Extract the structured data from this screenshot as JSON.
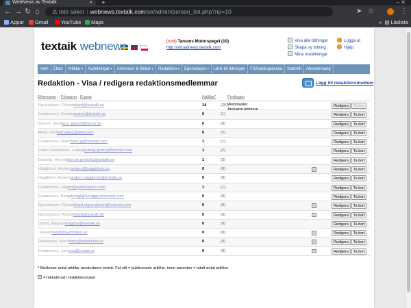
{
  "browser": {
    "tab_title": "WebNews av Textalk",
    "new_tab": "+",
    "window_controls": "– ✕",
    "insecure_label": "Inte säker",
    "url_host": "webnews.textalk.com",
    "url_path": "/se/admin/person_list.php?np=10",
    "bookmarks": [
      "Appar",
      "Gmail",
      "YouTube",
      "Maps"
    ],
    "bookmarks_right": "Läslista",
    "icons": {
      "back": "←",
      "forward": "→",
      "reload": "↻",
      "home": "⌂",
      "warning": "⚠",
      "share": "➤",
      "star": "☆",
      "menu": "⋮",
      "bookmarks_overflow": "»",
      "reading_list": "▤"
    }
  },
  "header": {
    "logo_primary": "textaik",
    "logo_secondary": "webnews",
    "root_tag": "(root)",
    "site_name": "Tanums Motorspegel (10)",
    "site_url": "http://virtualnews.textalk.com",
    "links_left": [
      "Visa alla tidningar",
      "Skapa ny tidning",
      "Mina inställningar"
    ],
    "links_right": [
      "Logga ut",
      "Hjälp"
    ]
  },
  "nav": [
    {
      "label": "Hem",
      "caret": false
    },
    {
      "label": "Ettan",
      "caret": false
    },
    {
      "label": "Artiklar",
      "caret": true
    },
    {
      "label": "Avdelningar",
      "caret": true
    },
    {
      "label": "Annonser & länkar",
      "caret": true
    },
    {
      "label": "Redaktion",
      "caret": true
    },
    {
      "label": "Egenskaper",
      "caret": true
    },
    {
      "label": "Länk till tidningen",
      "caret": false
    },
    {
      "label": "Förhandsgranska",
      "caret": false
    },
    {
      "label": "Statistik",
      "caret": false
    },
    {
      "label": "Abonnemang",
      "caret": false
    }
  ],
  "page": {
    "title": "Redaktion - Visa / redigera redaktionsmedlemmar",
    "add_member_label": "Lägg till redaktionsmedlem"
  },
  "table": {
    "columns": {
      "surname": "Efternamn",
      "firstname": "Förnamn",
      "email": "E-post",
      "articles": "Artiklar*",
      "privileges": "Privilegier"
    },
    "edit_label": "Redigera",
    "delete_label": "Ta bort",
    "rows": [
      {
        "name": "Sigvardsson, Rikard",
        "email": "rikard@textalk.se",
        "articles": "14",
        "total": "(25)",
        "privileges": [
          "Webmaster",
          "Ansvarig utgivare"
        ],
        "included": false,
        "delete_disabled": true
      },
      {
        "name": "Gustavsson, Svante",
        "email": "svante@textalk.se",
        "articles": "0",
        "total": "(1)",
        "privileges": [],
        "included": false,
        "delete_disabled": false
      },
      {
        "name": "Nilsson, Jens",
        "email": "jens.nilsson@home.se",
        "articles": "0",
        "total": "(0)",
        "privileges": [],
        "included": false,
        "delete_disabled": false
      },
      {
        "name": "Alling, Olof",
        "email": "olof.alling@telia.com",
        "articles": "0",
        "total": "(2)",
        "privileges": [],
        "included": false,
        "delete_disabled": false
      },
      {
        "name": "Gustavsson, Hans",
        "email": "hans.g@hotmail.com",
        "articles": "1",
        "total": "(1)",
        "privileges": [],
        "included": false,
        "delete_disabled": false
      },
      {
        "name": "Grahn Danielsson, Ludwig",
        "email": "ludwig.grahn@hotmail.com",
        "articles": "1",
        "total": "(2)",
        "privileges": [],
        "included": false,
        "delete_disabled": false
      },
      {
        "name": "Gestolla, Henryk",
        "email": "henryk.gestolla@textalk.se",
        "articles": "1",
        "total": "(2)",
        "privileges": [],
        "included": false,
        "delete_disabled": false
      },
      {
        "name": "Häggblom, Anders",
        "email": "anders@haggblom.nu",
        "articles": "0",
        "total": "(0)",
        "privileges": [],
        "included": true,
        "delete_disabled": false
      },
      {
        "name": "Häggblom, Anders",
        "email": "anders.haggblom@textalk.se",
        "articles": "0",
        "total": "(0)",
        "privileges": [],
        "included": false,
        "delete_disabled": false
      },
      {
        "name": "Gustavsson, Jan",
        "email": "jan@gustavsson.com",
        "articles": "1",
        "total": "(1)",
        "privileges": [],
        "included": false,
        "delete_disabled": false
      },
      {
        "name": "Gustavsson, Bengt",
        "email": "bengt@bengtgustavsson.com",
        "articles": "0",
        "total": "(0)",
        "privileges": [],
        "included": false,
        "delete_disabled": false
      },
      {
        "name": "Sigvardsson, Rikard",
        "email": "rikard.sigvardsson@hotmail.com",
        "articles": "0",
        "total": "(0)",
        "privileges": [],
        "included": true,
        "delete_disabled": false
      },
      {
        "name": "Sigvardsson, Rikard",
        "email": "rikard@textalk.dk",
        "articles": "0",
        "total": "(0)",
        "privileges": [],
        "included": true,
        "delete_disabled": false
      },
      {
        "name": "Lundh, Magnus",
        "email": "magnus@textalk.se",
        "articles": "0",
        "total": "(0)",
        "privileges": [],
        "included": false,
        "delete_disabled": false
      },
      {
        "name": ", Rikard",
        "email": "rikard@webfolket.se",
        "articles": "0",
        "total": "(0)",
        "privileges": [],
        "included": true,
        "delete_disabled": false
      },
      {
        "name": "Danielsson, Karin",
        "email": "karin@webfolket.se",
        "articles": "0",
        "total": "(0)",
        "privileges": [],
        "included": true,
        "delete_disabled": false
      },
      {
        "name": "Gustavsson, Lars",
        "email": "lars@rabart.se",
        "articles": "0",
        "total": "(0)",
        "privileges": [],
        "included": true,
        "delete_disabled": false
      }
    ]
  },
  "footnote": "* Beskriver antal artiklar användaren skrivit. Fet stil = publicerade artiklar, inom parentes = totalt antal artiklar.",
  "legend": "= Inkluderad i redaktionsrutan"
}
